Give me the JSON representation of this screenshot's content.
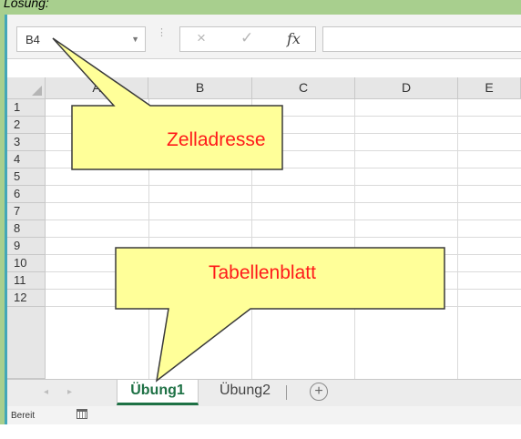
{
  "banner": {
    "text": "Lösung:"
  },
  "formula_bar": {
    "name_box_value": "B4",
    "name_box_dropdown_icon": "chevron-down-icon",
    "cancel_icon": "×",
    "enter_icon": "✓",
    "function_icon": "fx",
    "formula_value": ""
  },
  "grid": {
    "columns": [
      "A",
      "B",
      "C",
      "D",
      "E"
    ],
    "rows": [
      "1",
      "2",
      "3",
      "4",
      "5",
      "6",
      "7",
      "8",
      "9",
      "10",
      "11",
      "12"
    ]
  },
  "sheets": {
    "tabs": [
      "Übung1",
      "Übung2"
    ],
    "active": "Übung1",
    "add_icon": "+"
  },
  "status": {
    "text": "Bereit"
  },
  "callouts": {
    "cell_address": "Zelladresse",
    "worksheet": "Tabellenblatt",
    "fill_color": "#ffff99",
    "text_color": "#ff1a1a"
  }
}
